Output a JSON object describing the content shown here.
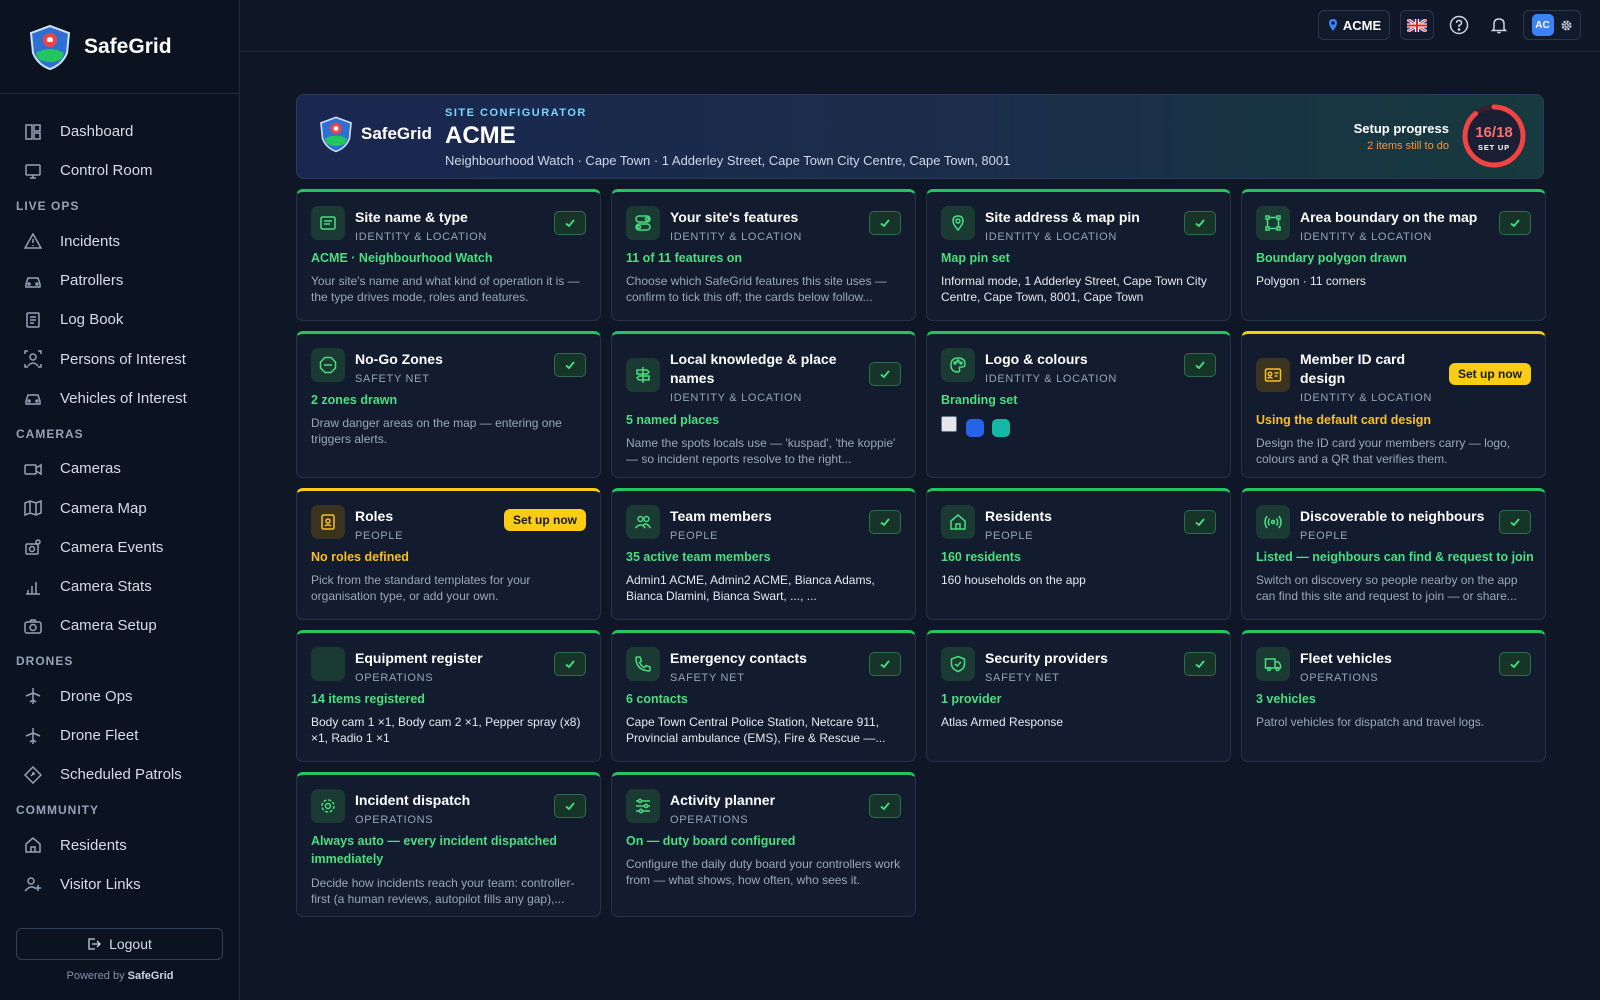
{
  "app": {
    "name": "SafeGrid",
    "powered_prefix": "Powered by",
    "powered_brand": "SafeGrid",
    "logout": "Logout"
  },
  "sidebar": {
    "top_items": [
      {
        "label": "Dashboard",
        "icon": "dashboard-icon"
      },
      {
        "label": "Control Room",
        "icon": "monitor-icon"
      }
    ],
    "sections": [
      {
        "title": "LIVE OPS",
        "items": [
          {
            "label": "Incidents"
          },
          {
            "label": "Patrollers"
          },
          {
            "label": "Log Book"
          },
          {
            "label": "Persons of Interest"
          },
          {
            "label": "Vehicles of Interest"
          }
        ]
      },
      {
        "title": "CAMERAS",
        "items": [
          {
            "label": "Cameras"
          },
          {
            "label": "Camera Map"
          },
          {
            "label": "Camera Events"
          },
          {
            "label": "Camera Stats"
          },
          {
            "label": "Camera Setup"
          }
        ]
      },
      {
        "title": "DRONES",
        "items": [
          {
            "label": "Drone Ops"
          },
          {
            "label": "Drone Fleet"
          },
          {
            "label": "Scheduled Patrols"
          }
        ]
      },
      {
        "title": "COMMUNITY",
        "items": [
          {
            "label": "Residents"
          },
          {
            "label": "Visitor Links"
          }
        ]
      }
    ]
  },
  "topbar": {
    "site": "ACME",
    "avatar": "AC",
    "flag": "uk-flag-icon"
  },
  "header": {
    "kicker": "SITE CONFIGURATOR",
    "title": "ACME",
    "subtitle": "Neighbourhood Watch · Cape Town · 1 Adderley Street, Cape Town City Centre, Cape Town, 8001",
    "progress_label": "Setup progress",
    "progress_note": "2 items still to do",
    "progress_value": "16/18",
    "progress_caption": "SET UP",
    "progress_fraction": 0.889
  },
  "cards": [
    {
      "title": "Site name & type",
      "category": "IDENTITY & LOCATION",
      "status": "ACME · Neighbourhood Watch",
      "desc": "Your site's name and what kind of operation it is — the type drives mode, roles and features.",
      "done": true
    },
    {
      "title": "Your site's features",
      "category": "IDENTITY & LOCATION",
      "status": "11 of 11 features on",
      "desc": "Choose which SafeGrid features this site uses — confirm to tick this off; the cards below follow...",
      "done": true
    },
    {
      "title": "Site address & map pin",
      "category": "IDENTITY & LOCATION",
      "status": "Map pin set",
      "desc": "Informal mode, 1 Adderley Street, Cape Town City Centre, Cape Town, 8001, Cape Town",
      "done": true
    },
    {
      "title": "Area boundary on the map",
      "category": "IDENTITY & LOCATION",
      "status": "Boundary polygon drawn",
      "desc": "Polygon · 11 corners",
      "done": true
    },
    {
      "title": "No-Go Zones",
      "category": "SAFETY NET",
      "status": "2 zones drawn",
      "desc": "Draw danger areas on the map — entering one triggers alerts.",
      "done": true
    },
    {
      "title": "Local knowledge & place names",
      "category": "IDENTITY & LOCATION",
      "status": "5 named places",
      "desc": "Name the spots locals use — 'kuspad', 'the koppie' — so incident reports resolve to the right...",
      "done": true
    },
    {
      "title": "Logo & colours",
      "category": "IDENTITY & LOCATION",
      "status": "Branding set",
      "desc": "",
      "done": true
    },
    {
      "title": "Member ID card design",
      "category": "IDENTITY & LOCATION",
      "status": "Using the default card design",
      "desc": "Design the ID card your members carry — logo, colours and a QR that verifies them.",
      "done": false,
      "action": "Set up now"
    },
    {
      "title": "Roles",
      "category": "PEOPLE",
      "status": "No roles defined",
      "desc": "Pick from the standard templates for your organisation type, or add your own.",
      "done": false,
      "action": "Set up now"
    },
    {
      "title": "Team members",
      "category": "PEOPLE",
      "status": "35 active team members",
      "desc": "Admin1 ACME, Admin2 ACME, Bianca Adams, Bianca Dlamini, Bianca Swart, ..., ...",
      "done": true
    },
    {
      "title": "Residents",
      "category": "PEOPLE",
      "status": "160 residents",
      "desc": "160 households on the app",
      "done": true
    },
    {
      "title": "Discoverable to neighbours",
      "category": "PEOPLE",
      "status": "Listed — neighbours can find & request to join",
      "desc": "Switch on discovery so people nearby on the app can find this site and request to join — or share...",
      "done": true
    },
    {
      "title": "Equipment register",
      "category": "OPERATIONS",
      "status": "14 items registered",
      "desc": "Body cam 1 ×1, Body cam 2 ×1, Pepper spray (x8) ×1, Radio 1 ×1",
      "done": true
    },
    {
      "title": "Emergency contacts",
      "category": "SAFETY NET",
      "status": "6 contacts",
      "desc": "Cape Town Central Police Station, Netcare 911, Provincial ambulance (EMS), Fire & Rescue —...",
      "done": true
    },
    {
      "title": "Security providers",
      "category": "SAFETY NET",
      "status": "1 provider",
      "desc": "Atlas Armed Response",
      "done": true
    },
    {
      "title": "Fleet vehicles",
      "category": "OPERATIONS",
      "status": "3 vehicles",
      "desc": "Patrol vehicles for dispatch and travel logs.",
      "done": true
    },
    {
      "title": "Incident dispatch",
      "category": "OPERATIONS",
      "status": "Always auto — every incident dispatched immediately",
      "desc": "Decide how incidents reach your team: controller-first (a human reviews, autopilot fills any gap),...",
      "done": true
    },
    {
      "title": "Activity planner",
      "category": "OPERATIONS",
      "status": "On — duty board configured",
      "desc": "Configure the daily duty board your controllers work from — what shows, how often, who sees it.",
      "done": true
    }
  ],
  "branding_colors": [
    "#2563eb",
    "#14b8a6"
  ]
}
